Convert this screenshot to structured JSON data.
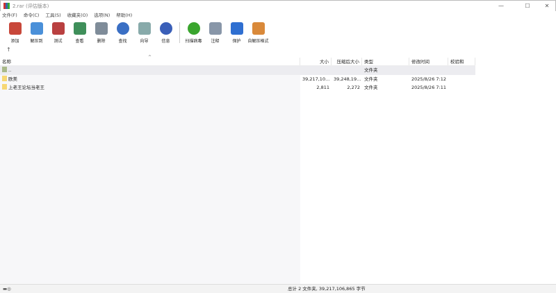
{
  "window": {
    "title": "2.rar (评估版本)",
    "controls": [
      "—",
      "☐",
      "✕"
    ]
  },
  "menu": [
    "文件(F)",
    "命令(C)",
    "工具(S)",
    "收藏夹(O)",
    "选项(N)",
    "帮助(H)"
  ],
  "toolbar": [
    {
      "label": "添加",
      "icon": "add-archive-icon",
      "color": "#c8473a"
    },
    {
      "label": "解压到",
      "icon": "extract-folder-icon",
      "color": "#4a90d9"
    },
    {
      "label": "测试",
      "icon": "test-icon",
      "color": "#b94040"
    },
    {
      "label": "查看",
      "icon": "view-book-icon",
      "color": "#3f8f5a"
    },
    {
      "label": "删除",
      "icon": "delete-trash-icon",
      "color": "#7f8c99"
    },
    {
      "label": "查找",
      "icon": "find-magnifier-icon",
      "color": "#3a6fc4"
    },
    {
      "label": "向导",
      "icon": "wizard-wand-icon",
      "color": "#8aa"
    },
    {
      "label": "信息",
      "icon": "info-icon",
      "color": "#3a5fb8"
    },
    {
      "label": "扫描病毒",
      "icon": "virus-scan-icon",
      "color": "#3aa52e"
    },
    {
      "label": "注释",
      "icon": "comment-icon",
      "color": "#8896a8"
    },
    {
      "label": "保护",
      "icon": "protect-shield-icon",
      "color": "#2f6fd1"
    },
    {
      "label": "自解压格式",
      "icon": "sfx-icon",
      "color": "#d9893a"
    }
  ],
  "columns": [
    "名称",
    "大小",
    "压缩后大小",
    "类型",
    "修改时间",
    "校验和"
  ],
  "rows": [
    {
      "name": "..",
      "size": "",
      "packed": "",
      "type": "文件夹",
      "modified": "",
      "crc": ""
    },
    {
      "name": "欧美",
      "size": "39,217,10...",
      "packed": "39,248,19...",
      "type": "文件夹",
      "modified": "2025/8/26 7:12",
      "crc": ""
    },
    {
      "name": "上老王论坛当老王",
      "size": "2,811",
      "packed": "2,272",
      "type": "文件夹",
      "modified": "2025/8/26 7:11",
      "crc": ""
    }
  ],
  "status": {
    "summary": "总计 2 文件夹, 39,217,106,865 字节"
  }
}
